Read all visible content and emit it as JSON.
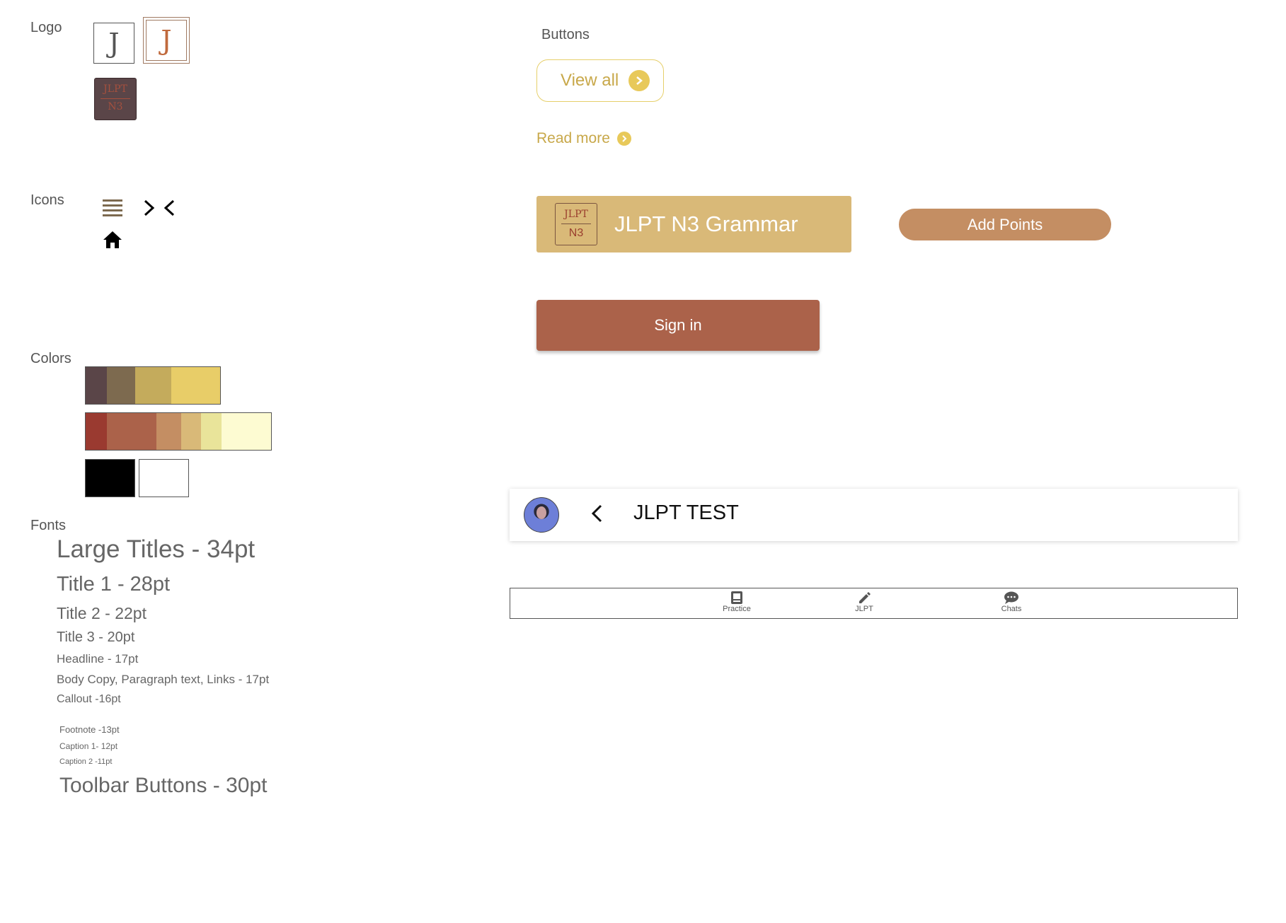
{
  "sections": {
    "logo": "Logo",
    "icons": "Icons",
    "colors": "Colors",
    "fonts": "Fonts",
    "buttons": "Buttons"
  },
  "logos": {
    "letter": "J",
    "badge_top": "JLPT",
    "badge_bottom": "N3"
  },
  "icons": [
    "menu-lines-icon",
    "collapse-chevrons-icon",
    "home-icon"
  ],
  "palette": {
    "row1": [
      "#5a4548",
      "#7d6a4f",
      "#c4ab5c",
      "#e8cd68"
    ],
    "row2": [
      "#9a3a30",
      "#ab624a",
      "#c48e63",
      "#d9b978",
      "#e9e49a",
      "#fdfbd2"
    ],
    "row3": [
      "#000000",
      "#ffffff"
    ]
  },
  "fonts": {
    "large_titles": "Large Titles - 34pt",
    "title1": "Title 1 - 28pt",
    "title2": "Title 2 - 22pt",
    "title3": "Title 3 - 20pt",
    "headline": "Headline - 17pt",
    "body": "Body Copy, Paragraph text, Links - 17pt",
    "callout": "Callout -16pt",
    "footnote": "Footnote -13pt",
    "caption1": "Caption 1- 12pt",
    "caption2": "Caption 2 -11pt",
    "toolbar": "Toolbar Buttons - 30pt"
  },
  "buttons": {
    "view_all": "View all",
    "read_more": "Read more",
    "grammar_badge_top": "JLPT",
    "grammar_badge_bottom": "N3",
    "grammar_title": "JLPT N3 Grammar",
    "add_points": "Add Points",
    "sign_in": "Sign in"
  },
  "header": {
    "title": "JLPT TEST"
  },
  "tabbar": {
    "tabs": [
      {
        "label": "Practice",
        "icon": "book-icon"
      },
      {
        "label": "JLPT",
        "icon": "pencil-icon"
      },
      {
        "label": "Chats",
        "icon": "chat-bubble-icon"
      }
    ]
  }
}
